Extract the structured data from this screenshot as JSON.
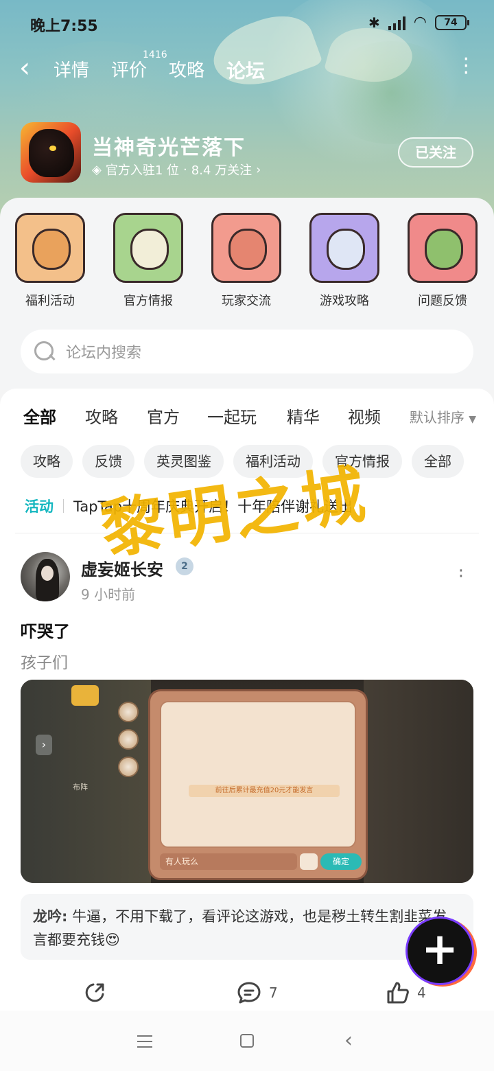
{
  "status_bar": {
    "time": "晚上7:55",
    "battery": "74"
  },
  "nav": {
    "tabs": [
      {
        "label": "详情"
      },
      {
        "label": "评价"
      },
      {
        "label": "攻略"
      },
      {
        "label": "论坛"
      }
    ],
    "review_count": "1416",
    "active_tab": "论坛"
  },
  "game": {
    "title": "当神奇光芒落下",
    "official_text": "官方入驻1 位",
    "followers_text": "8.4 万关注",
    "follow_label": "已关注"
  },
  "categories": [
    {
      "label": "福利活动",
      "color": "#f3c08a"
    },
    {
      "label": "官方情报",
      "color": "#a8d48e"
    },
    {
      "label": "玩家交流",
      "color": "#f29b8e"
    },
    {
      "label": "游戏攻略",
      "color": "#b7a6ec"
    },
    {
      "label": "问题反馈",
      "color": "#f08a8a"
    }
  ],
  "search": {
    "placeholder": "论坛内搜索"
  },
  "feed_tabs": [
    "全部",
    "攻略",
    "官方",
    "一起玩",
    "精华",
    "视频"
  ],
  "sort_label": "默认排序",
  "chips": [
    "攻略",
    "反馈",
    "英灵图鉴",
    "福利活动",
    "官方情报",
    "全部"
  ],
  "activity": {
    "tag": "活动",
    "text": "TapTap十周年庆典开启！十年陪伴谢礼送出"
  },
  "post": {
    "author": "虚妄姬长安",
    "level": "2",
    "time": "9 小时前",
    "title": "吓哭了",
    "body": "孩子们",
    "screenshot": {
      "input_text": "有人玩么",
      "ok_label": "确定",
      "notice": "前往后累计最充值20元才能发言",
      "side_label": "布阵"
    },
    "comment": {
      "author": "龙吟:",
      "text": " 牛逼，不用下载了，看评论这游戏，也是秽土转生割韭菜发言都要充钱😍"
    },
    "actions": {
      "comments": "7",
      "likes": "4"
    }
  },
  "watermark": "黎明之城",
  "colors": {
    "accent": "#15c5ce",
    "watermark": "#f2b400"
  }
}
